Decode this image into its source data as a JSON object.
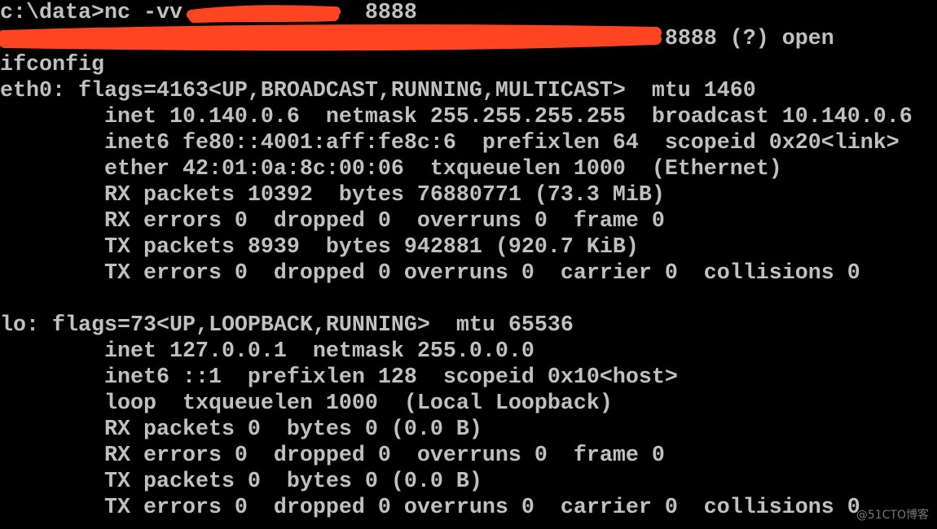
{
  "colors": {
    "background": "#000000",
    "text": "#c0c0c0",
    "redaction": "#ff4422"
  },
  "terminal": {
    "command_line": {
      "prefix": "c:\\data>nc -vv ",
      "redacted": "            ",
      "suffix": " 8888"
    },
    "connect_line": {
      "redacted": "                                                  ",
      "suffix": " 8888 (?) open"
    },
    "lines": [
      "ifconfig",
      "eth0: flags=4163<UP,BROADCAST,RUNNING,MULTICAST>  mtu 1460",
      "        inet 10.140.0.6  netmask 255.255.255.255  broadcast 10.140.0.6",
      "        inet6 fe80::4001:aff:fe8c:6  prefixlen 64  scopeid 0x20<link>",
      "        ether 42:01:0a:8c:00:06  txqueuelen 1000  (Ethernet)",
      "        RX packets 10392  bytes 76880771 (73.3 MiB)",
      "        RX errors 0  dropped 0  overruns 0  frame 0",
      "        TX packets 8939  bytes 942881 (920.7 KiB)",
      "        TX errors 0  dropped 0 overruns 0  carrier 0  collisions 0",
      "",
      "lo: flags=73<UP,LOOPBACK,RUNNING>  mtu 65536",
      "        inet 127.0.0.1  netmask 255.0.0.0",
      "        inet6 ::1  prefixlen 128  scopeid 0x10<host>",
      "        loop  txqueuelen 1000  (Local Loopback)",
      "        RX packets 0  bytes 0 (0.0 B)",
      "        RX errors 0  dropped 0  overruns 0  frame 0",
      "        TX packets 0  bytes 0 (0.0 B)",
      "        TX errors 0  dropped 0 overruns 0  carrier 0  collisions 0"
    ]
  },
  "watermark": "@51CTO博客"
}
